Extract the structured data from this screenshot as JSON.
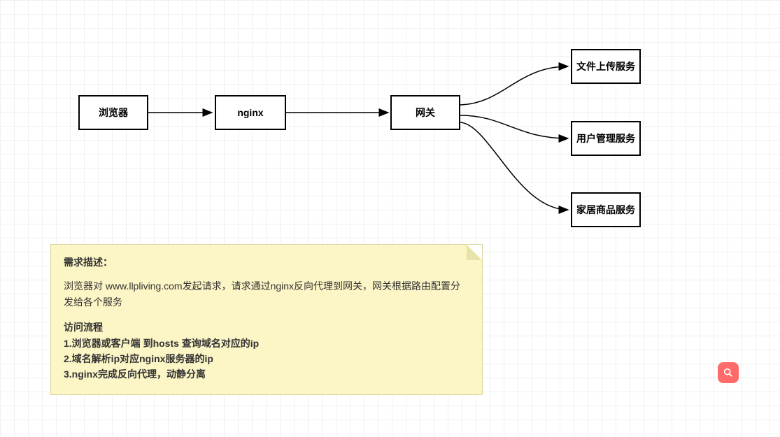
{
  "nodes": {
    "browser": {
      "label": "浏览器"
    },
    "nginx": {
      "label": "nginx"
    },
    "gateway": {
      "label": "网关"
    },
    "file_upload": {
      "label": "文件上传服务"
    },
    "user_mgmt": {
      "label": "用户管理服务"
    },
    "home_goods": {
      "label": "家居商品服务"
    }
  },
  "note": {
    "title": "需求描述：",
    "description": "浏览器对 www.llpliving.com发起请求，请求通过nginx反向代理到网关，网关根据路由配置分发给各个服务",
    "subtitle": "访问流程",
    "steps": [
      "1.浏览器或客户端 到hosts 查询域名对应的ip",
      "2.域名解析ip对应nginx服务器的ip",
      "3.nginx完成反向代理，动静分离"
    ]
  },
  "icons": {
    "search": "search-icon"
  }
}
